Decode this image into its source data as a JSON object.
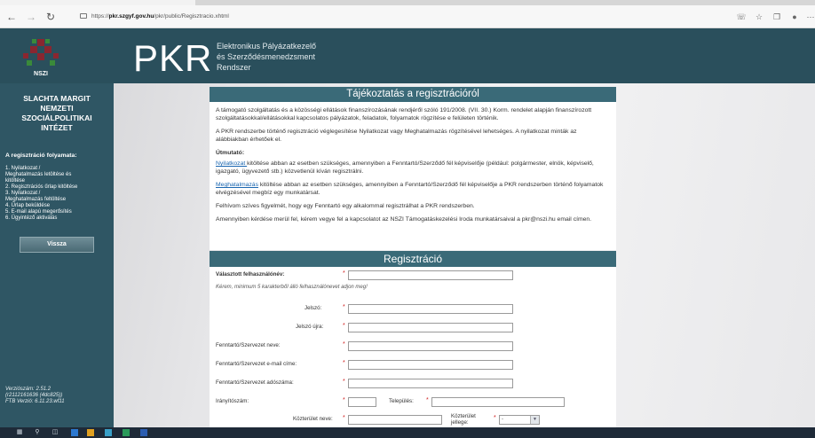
{
  "browser": {
    "back_icon": "arrow-left-icon",
    "url_prefix": "https://",
    "url_host": "pkr.szgyf.gov.hu",
    "url_path": "/pkr/public/Regisztracio.xhtml"
  },
  "header": {
    "logo_text": "NSZI",
    "brand": "PKR",
    "subtitle_line1": "Elektronikus Pályázatkezelő",
    "subtitle_line2": "és Szerződésmenedzsment",
    "subtitle_line3": "Rendszer"
  },
  "sidebar": {
    "org_line1": "SLACHTA MARGIT",
    "org_line2": "NEMZETI",
    "org_line3": "SZOCIÁLPOLITIKAI",
    "org_line4": "INTÉZET",
    "process_title": "A regisztráció folyamata:",
    "steps": [
      "1. Nyilatkozat /",
      "Meghatalmazás letöltése és",
      "kitöltése",
      "2. Regisztrációs űrlap kitöltése",
      "3. Nyilatkozat /",
      "Meghatalmazás feltöltése",
      "4. Űrlap beküldése",
      "5. E-mail alapú megerősítés",
      "6. Ügyintéző aktiválás"
    ],
    "back_label": "Vissza",
    "version_line1": "Verziószám: 2.51.2",
    "version_line2": "(r2112161636 (4dc825))",
    "version_line3": "FTB Verzió: 6.11.23.wf11"
  },
  "info": {
    "title": "Tájékoztatás a regisztrációról",
    "p1": "A támogató szolgáltatás és a közösségi ellátások finanszírozásának rendjéről szóló 191/2008. (VII. 30.) Korm. rendelet alapján finanszírozott szolgáltatásokkal/ellátásokkal kapcsolatos pályázatok, feladatok, folyamatok rögzítése e felületen történik.",
    "p2": "A PKR rendszerbe történő regisztráció véglegesítése Nyilatkozat vagy Meghatalmazás rögzítésével lehetséges. A nyilatkozat minták az alábbiakban érhetőek el.",
    "guide_title": "Útmutató:",
    "link1": "Nyilatkozat ",
    "p3": "kitöltése abban az esetben szükséges, amennyiben a Fenntartó/Szerződő fél képviselője (például: polgármester, elnök, képviselő, igazgató, ügyvezető stb.) közvetlenül kíván regisztrálni.",
    "link2": "Meghatalmazás",
    "p4": " kitöltése abban az esetben szükséges, amennyiben a Fenntartó/Szerződő fél képviselője a PKR rendszerben történő folyamatok elvégzésével megbíz egy munkatársat.",
    "p5": "Felhívom szíves figyelmét, hogy egy Fenntartó egy alkalommal regisztrálhat a PKR rendszerben.",
    "p6": "Amennyiben kérdése merül fel, kérem vegye fel a kapcsolatot az NSZI Támogatáskezelési Iroda munkatársaival a pkr@nszi.hu email címen."
  },
  "registration": {
    "title": "Regisztráció",
    "required_mark": "*",
    "username_label": "Választott felhasználónév:",
    "username_hint": "Kérem, minimum 5 karakterből álló felhasználónevet adjon meg!",
    "password_label": "Jelszó:",
    "password2_label": "Jelszó újra:",
    "org_name_label": "Fenntartó/Szervezet neve:",
    "org_email_label": "Fenntartó/Szervezet e-mail címe:",
    "org_tax_label": "Fenntartó/Szervezet adószáma:",
    "zip_label": "Irányítószám:",
    "city_label": "Település:",
    "street_label": "Közterület neve:",
    "street_type_label_1": "Közterület",
    "street_type_label_2": "jellege:",
    "street_type_value": "-"
  }
}
